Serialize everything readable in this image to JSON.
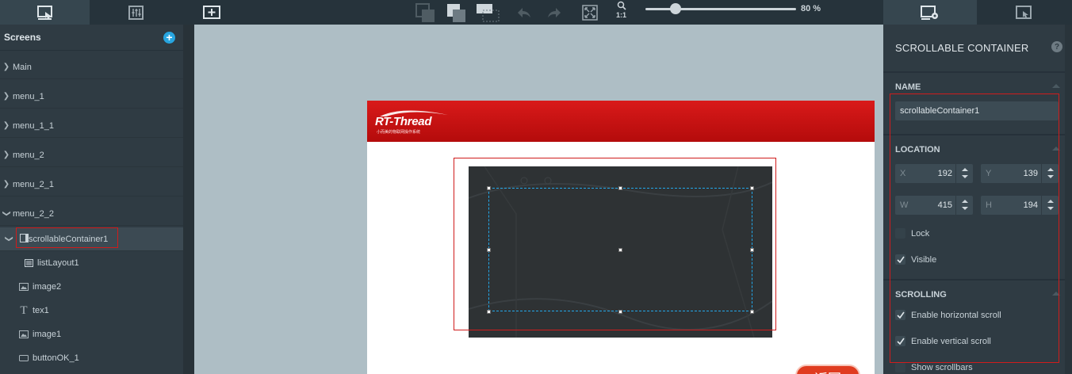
{
  "toolbar": {
    "zoom_percent": "80 %",
    "zoom_level": 0.2,
    "fit_label": "1:1",
    "left_tabs": [
      "screens-tab-icon",
      "widgets-tab-icon"
    ],
    "right_tabs": [
      "properties-tab-icon",
      "interactions-tab-icon"
    ]
  },
  "left_panel": {
    "title": "Screens",
    "screens": [
      {
        "label": "Main",
        "expanded": false
      },
      {
        "label": "menu_1",
        "expanded": false
      },
      {
        "label": "menu_1_1",
        "expanded": false
      },
      {
        "label": "menu_2",
        "expanded": false
      },
      {
        "label": "menu_2_1",
        "expanded": false
      },
      {
        "label": "menu_2_2",
        "expanded": true
      }
    ],
    "widgets": [
      {
        "label": "scrollableContainer1",
        "icon": "container-icon",
        "selected": true
      },
      {
        "label": "listLayout1",
        "icon": "list-layout-icon"
      },
      {
        "label": "image2",
        "icon": "image-icon"
      },
      {
        "label": "tex1",
        "icon": "text-icon"
      },
      {
        "label": "image1",
        "icon": "image-icon"
      },
      {
        "label": "buttonOK_1",
        "icon": "button-icon"
      }
    ]
  },
  "canvas": {
    "logo_text": "RT-Thread",
    "logo_subtitle": "小而美的物联网操作系统",
    "button_text": "返回"
  },
  "properties": {
    "title": "SCROLLABLE CONTAINER",
    "help": "?",
    "name_section": "NAME",
    "name_value": "scrollableContainer1",
    "location_section": "LOCATION",
    "x_label": "X",
    "x_value": "192",
    "y_label": "Y",
    "y_value": "139",
    "w_label": "W",
    "w_value": "415",
    "h_label": "H",
    "h_value": "194",
    "lock_label": "Lock",
    "lock_checked": false,
    "visible_label": "Visible",
    "visible_checked": true,
    "scrolling_section": "SCROLLING",
    "hscroll_label": "Enable horizontal scroll",
    "hscroll_checked": true,
    "vscroll_label": "Enable vertical scroll",
    "vscroll_checked": true,
    "scrollbars_label": "Show scrollbars",
    "scrollbars_checked": false
  },
  "colors": {
    "accent": "#27a5e0",
    "highlight": "#d01c1c",
    "selection": "#23a8ea",
    "header_red": "#c81313"
  }
}
